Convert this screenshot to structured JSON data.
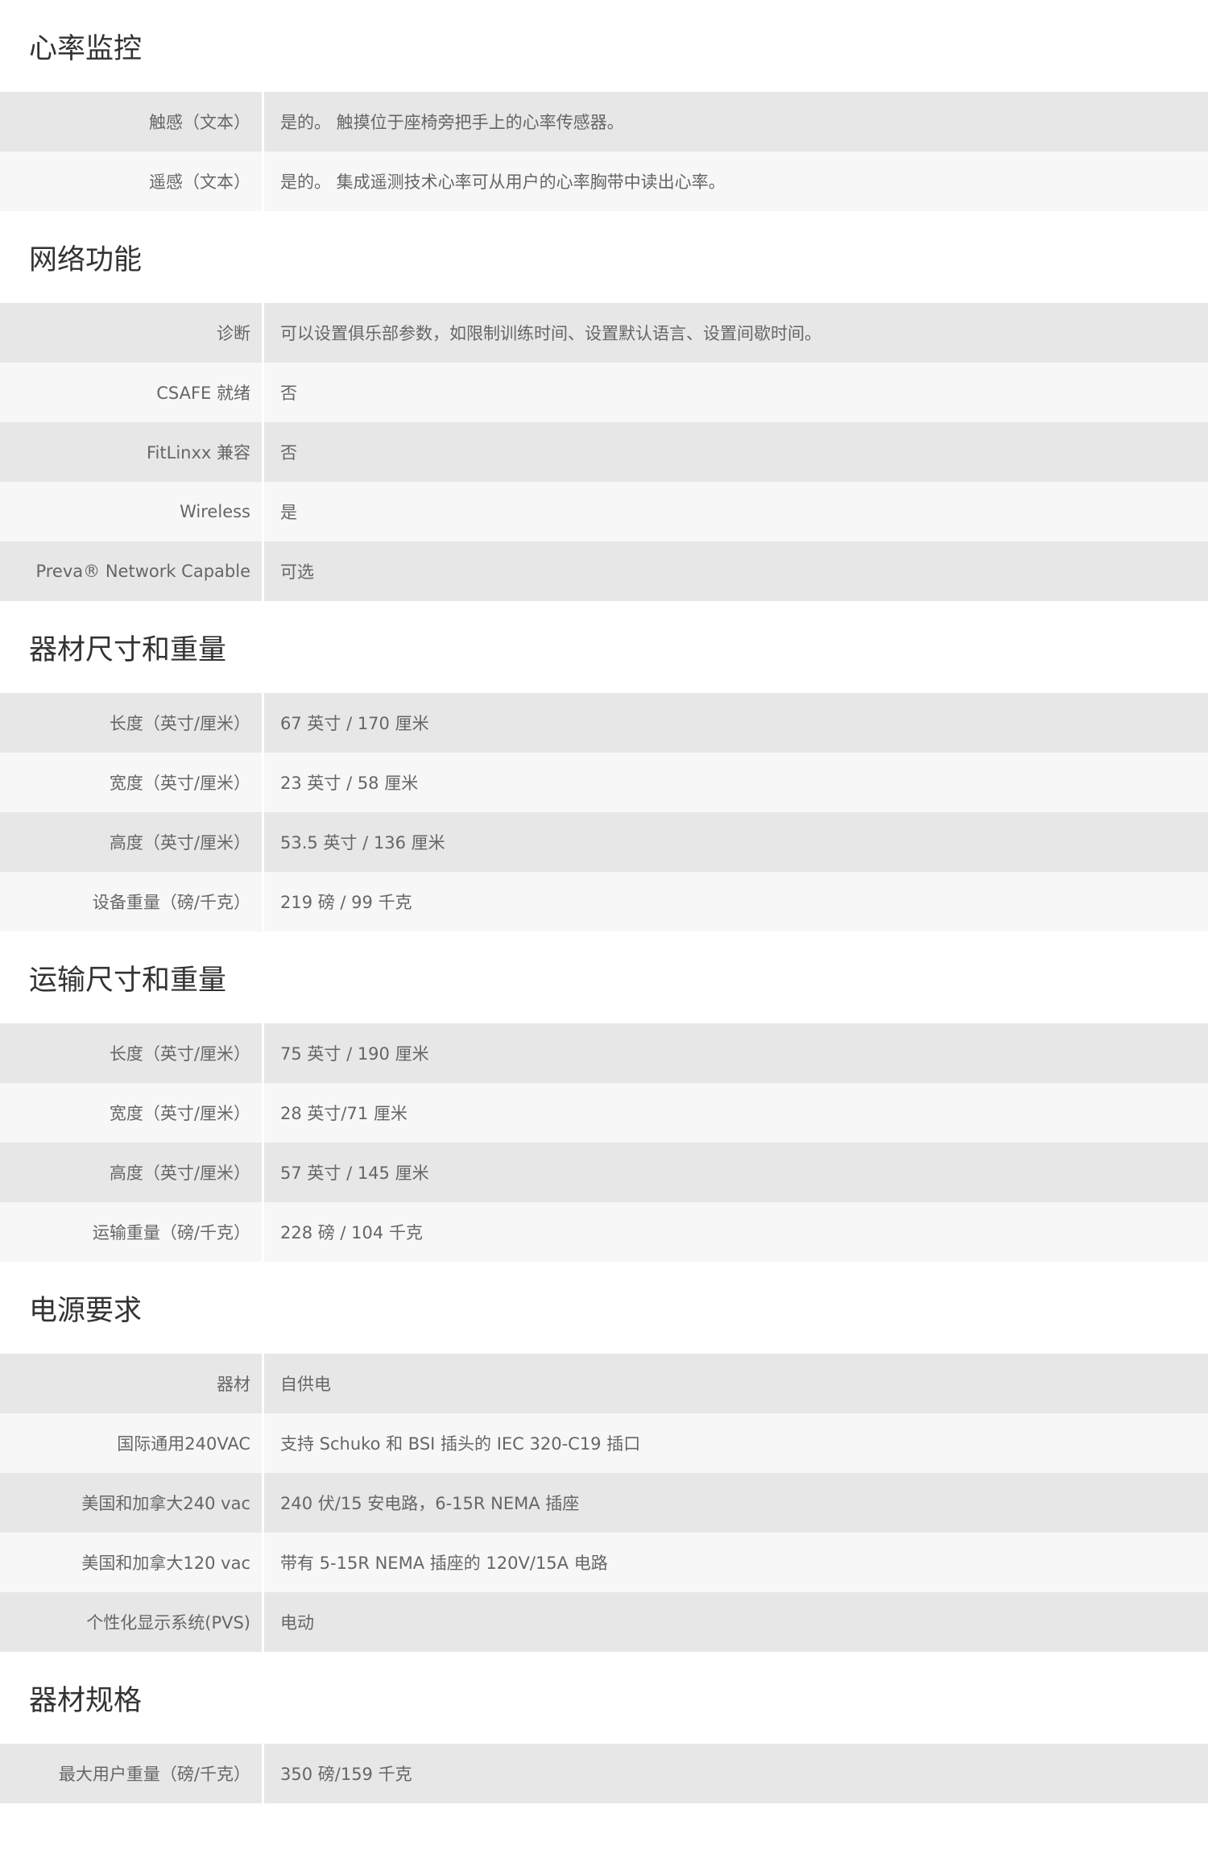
{
  "sections": [
    {
      "title": "心率监控",
      "rows": [
        {
          "label": "触感（文本）",
          "value": "是的。 触摸位于座椅旁把手上的心率传感器。"
        },
        {
          "label": "遥感（文本）",
          "value": "是的。 集成遥测技术心率可从用户的心率胸带中读出心率。"
        }
      ]
    },
    {
      "title": "网络功能",
      "rows": [
        {
          "label": "诊断",
          "value": "可以设置俱乐部参数，如限制训练时间、设置默认语言、设置间歇时间。"
        },
        {
          "label": "CSAFE 就绪",
          "value": "否"
        },
        {
          "label": "FitLinxx 兼容",
          "value": "否"
        },
        {
          "label": "Wireless",
          "value": "是"
        },
        {
          "label": "Preva® Network Capable",
          "value": "可选"
        }
      ]
    },
    {
      "title": "器材尺寸和重量",
      "rows": [
        {
          "label": "长度（英寸/厘米）",
          "value": "67 英寸 / 170 厘米"
        },
        {
          "label": "宽度（英寸/厘米）",
          "value": "23 英寸 / 58 厘米"
        },
        {
          "label": "高度（英寸/厘米）",
          "value": "53.5 英寸 / 136 厘米"
        },
        {
          "label": "设备重量（磅/千克）",
          "value": "219 磅 / 99 千克"
        }
      ]
    },
    {
      "title": "运输尺寸和重量",
      "rows": [
        {
          "label": "长度（英寸/厘米）",
          "value": "75 英寸 / 190 厘米"
        },
        {
          "label": "宽度（英寸/厘米）",
          "value": "28 英寸/71 厘米"
        },
        {
          "label": "高度（英寸/厘米）",
          "value": "57 英寸 / 145 厘米"
        },
        {
          "label": "运输重量（磅/千克）",
          "value": "228 磅 / 104 千克"
        }
      ]
    },
    {
      "title": "电源要求",
      "rows": [
        {
          "label": "器材",
          "value": "自供电"
        },
        {
          "label": "国际通用240VAC",
          "value": "支持 Schuko 和 BSI 插头的 IEC 320-C19 插口"
        },
        {
          "label": "美国和加拿大240 vac",
          "value": "240 伏/15 安电路，6-15R NEMA 插座"
        },
        {
          "label": "美国和加拿大120 vac",
          "value": "带有 5-15R NEMA 插座的 120V/15A 电路"
        },
        {
          "label": "个性化显示系统(PVS)",
          "value": "电动"
        }
      ]
    },
    {
      "title": "器材规格",
      "rows": [
        {
          "label": "最大用户重量（磅/千克）",
          "value": "350 磅/159 千克"
        }
      ]
    }
  ]
}
